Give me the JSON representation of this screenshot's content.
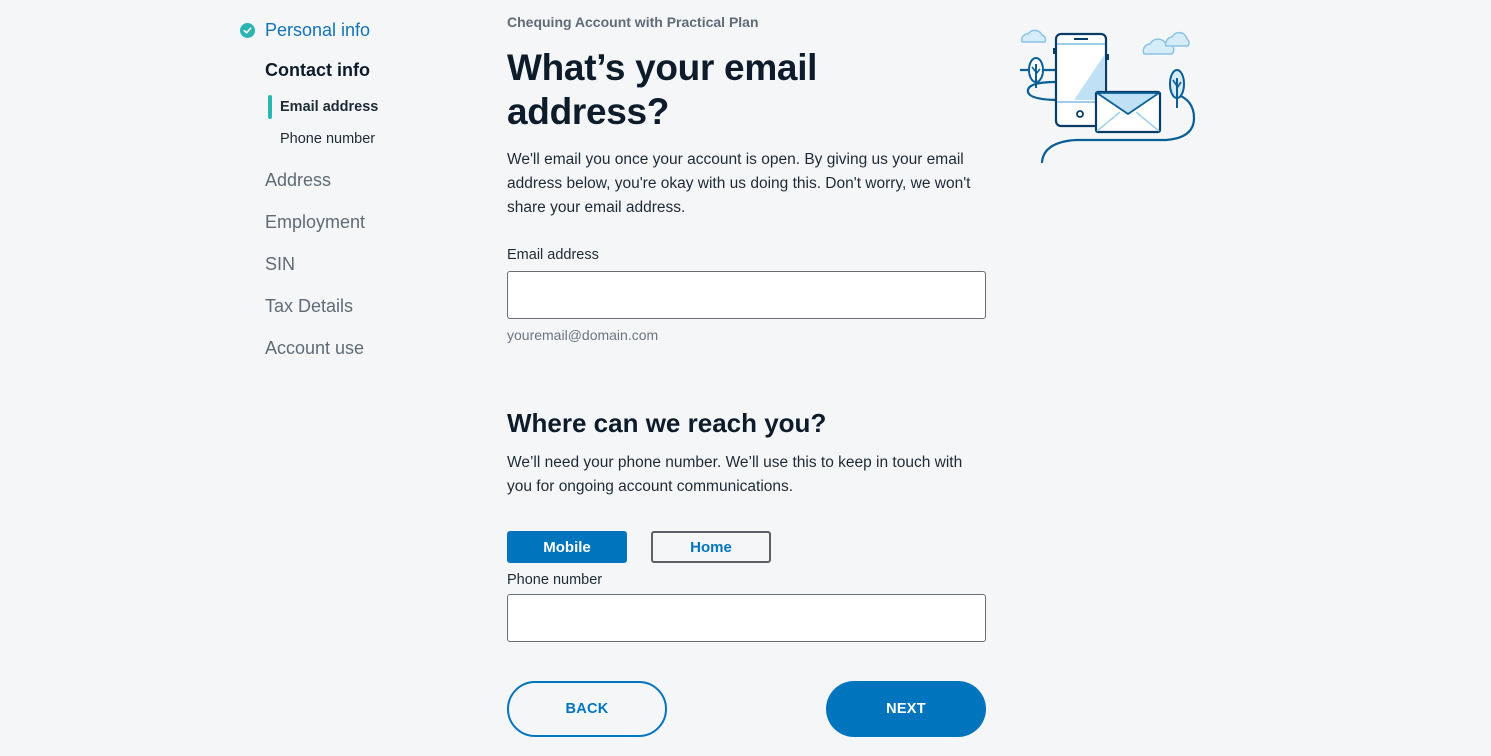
{
  "sidebar": {
    "completed_step": "Personal info",
    "current_step": "Contact info",
    "substeps": [
      {
        "label": "Email address",
        "active": true
      },
      {
        "label": "Phone number",
        "active": false
      }
    ],
    "future_steps": [
      "Address",
      "Employment",
      "SIN",
      "Tax Details",
      "Account use"
    ]
  },
  "main": {
    "eyebrow": "Chequing Account with Practical Plan",
    "email_section": {
      "title": "What’s your email address?",
      "description": "We'll email you once your account is open. By giving us your email address below, you're okay with us doing this. Don't worry, we won't share your email address.",
      "field_label": "Email address",
      "value": "",
      "hint": "youremail@domain.com"
    },
    "phone_section": {
      "title": "Where can we reach you?",
      "description": "We’ll need your phone number. We’ll use this to keep in touch with you for ongoing account communications.",
      "phone_types": [
        {
          "label": "Mobile",
          "selected": true
        },
        {
          "label": "Home",
          "selected": false
        }
      ],
      "field_label": "Phone number",
      "value": ""
    }
  },
  "actions": {
    "back_label": "BACK",
    "next_label": "NEXT"
  },
  "colors": {
    "primary": "#0074bd",
    "accent_teal": "#2bb5b2",
    "background": "#f4f6f8",
    "heading": "#0d1b2a",
    "muted": "#5f6b77"
  },
  "illustration": {
    "icon": "phone-and-envelope-illustration"
  }
}
